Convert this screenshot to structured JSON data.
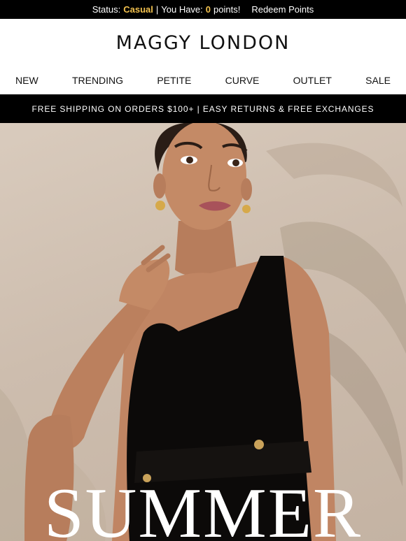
{
  "status_bar": {
    "status_label": "Status:",
    "status_value": "Casual",
    "separator": "|",
    "points_prefix": "You Have:",
    "points_value": "0",
    "points_suffix": "points!",
    "redeem_label": "Redeem Points",
    "highlight_color": "#f2c14e"
  },
  "brand": {
    "name": "MAGGY LONDON"
  },
  "nav": {
    "items": [
      {
        "label": "NEW"
      },
      {
        "label": "TRENDING"
      },
      {
        "label": "PETITE"
      },
      {
        "label": "CURVE"
      },
      {
        "label": "OUTLET"
      },
      {
        "label": "SALE"
      }
    ]
  },
  "promo_bar": {
    "text": "FREE SHIPPING ON ORDERS $100+ | EASY RETURNS & FREE EXCHANGES"
  },
  "hero": {
    "title": "SUMMER",
    "image_alt": "model-in-black-dress"
  }
}
